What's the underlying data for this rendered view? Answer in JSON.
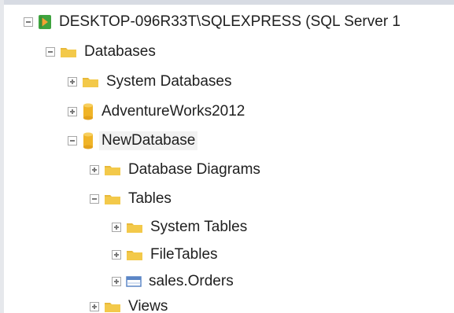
{
  "tree": {
    "server": {
      "label": "DESKTOP-096R33T\\SQLEXPRESS (SQL Server 1",
      "icon": "server-icon",
      "expanded": true
    },
    "databases": {
      "label": "Databases",
      "icon": "folder-icon",
      "expanded": true
    },
    "system_databases": {
      "label": "System Databases",
      "icon": "folder-icon",
      "expanded": false
    },
    "adventureworks": {
      "label": "AdventureWorks2012",
      "icon": "database-icon",
      "expanded": false
    },
    "newdatabase": {
      "label": "NewDatabase",
      "icon": "database-icon",
      "expanded": true,
      "selected": true
    },
    "database_diagrams": {
      "label": "Database Diagrams",
      "icon": "folder-icon",
      "expanded": false
    },
    "tables": {
      "label": "Tables",
      "icon": "folder-icon",
      "expanded": true
    },
    "system_tables": {
      "label": "System Tables",
      "icon": "folder-icon",
      "expanded": false
    },
    "filetables": {
      "label": "FileTables",
      "icon": "folder-icon",
      "expanded": false
    },
    "sales_orders": {
      "label": "sales.Orders",
      "icon": "table-icon",
      "expanded": false
    },
    "views": {
      "label": "Views",
      "icon": "folder-icon",
      "expanded": false
    }
  },
  "colors": {
    "folder": "#e8b93a",
    "folder_dark": "#c99a1f",
    "database": "#f0b428",
    "server_green": "#3fa33f",
    "server_orange": "#f3a233",
    "table_blue": "#5b86c6",
    "selected_bg": "#f2f2f2"
  }
}
